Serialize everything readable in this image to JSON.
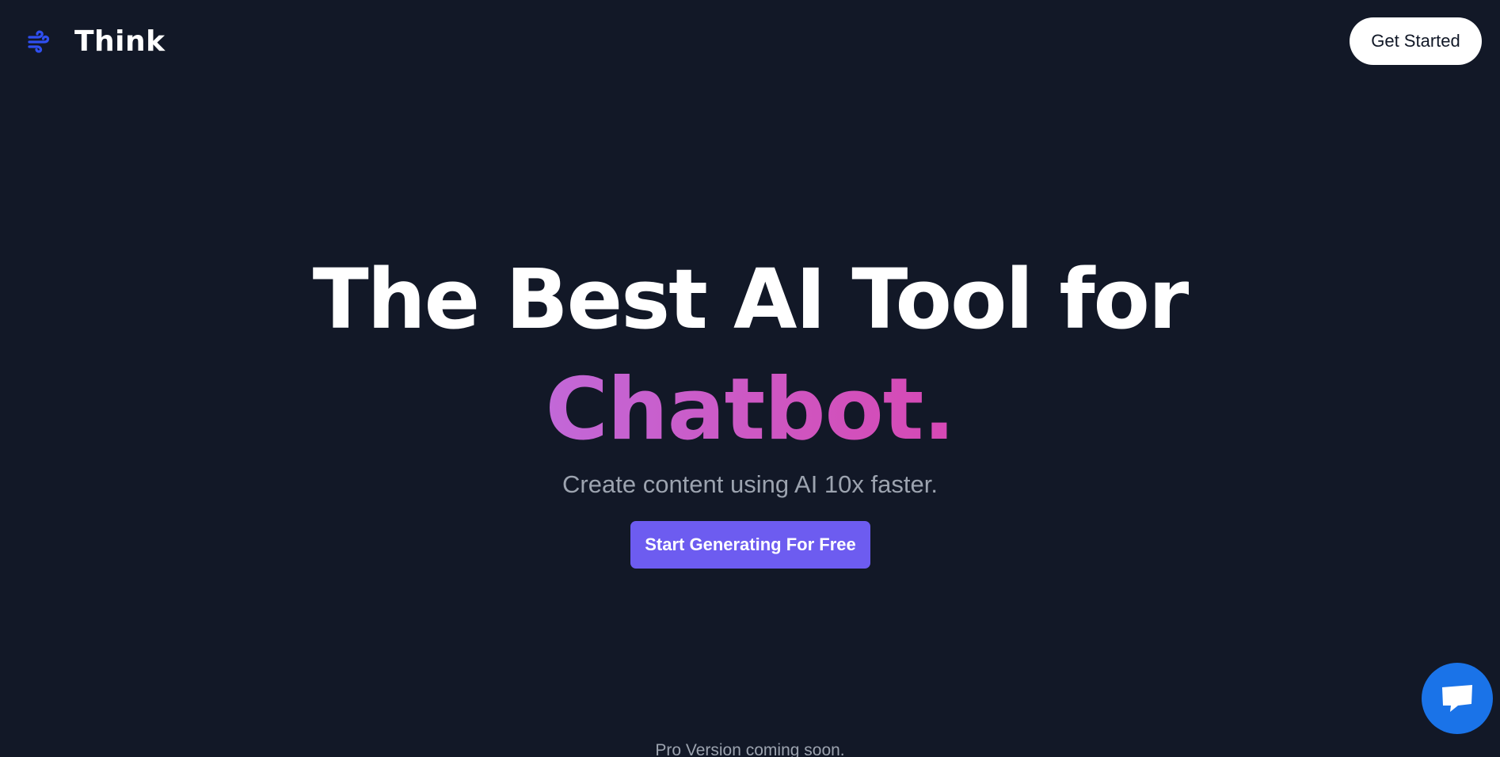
{
  "header": {
    "brand_name": "Think",
    "brand_icon": "wind-icon",
    "get_started_label": "Get Started"
  },
  "hero": {
    "headline_line1": "The Best AI Tool for",
    "headline_highlight": "Chatbot.",
    "subtitle": "Create content using AI 10x faster.",
    "cta_label": "Start Generating For Free"
  },
  "footer": {
    "note": "Pro Version coming soon."
  },
  "chat_widget": {
    "icon": "chat-icon"
  },
  "colors": {
    "background": "#121827",
    "brand_icon": "#2f4ff0",
    "highlight_gradient_start": "#c268d8",
    "highlight_gradient_end": "#d648b4",
    "cta_background": "#6d5cf0",
    "chat_bubble": "#1a73e8",
    "muted_text": "#9ca3af"
  }
}
